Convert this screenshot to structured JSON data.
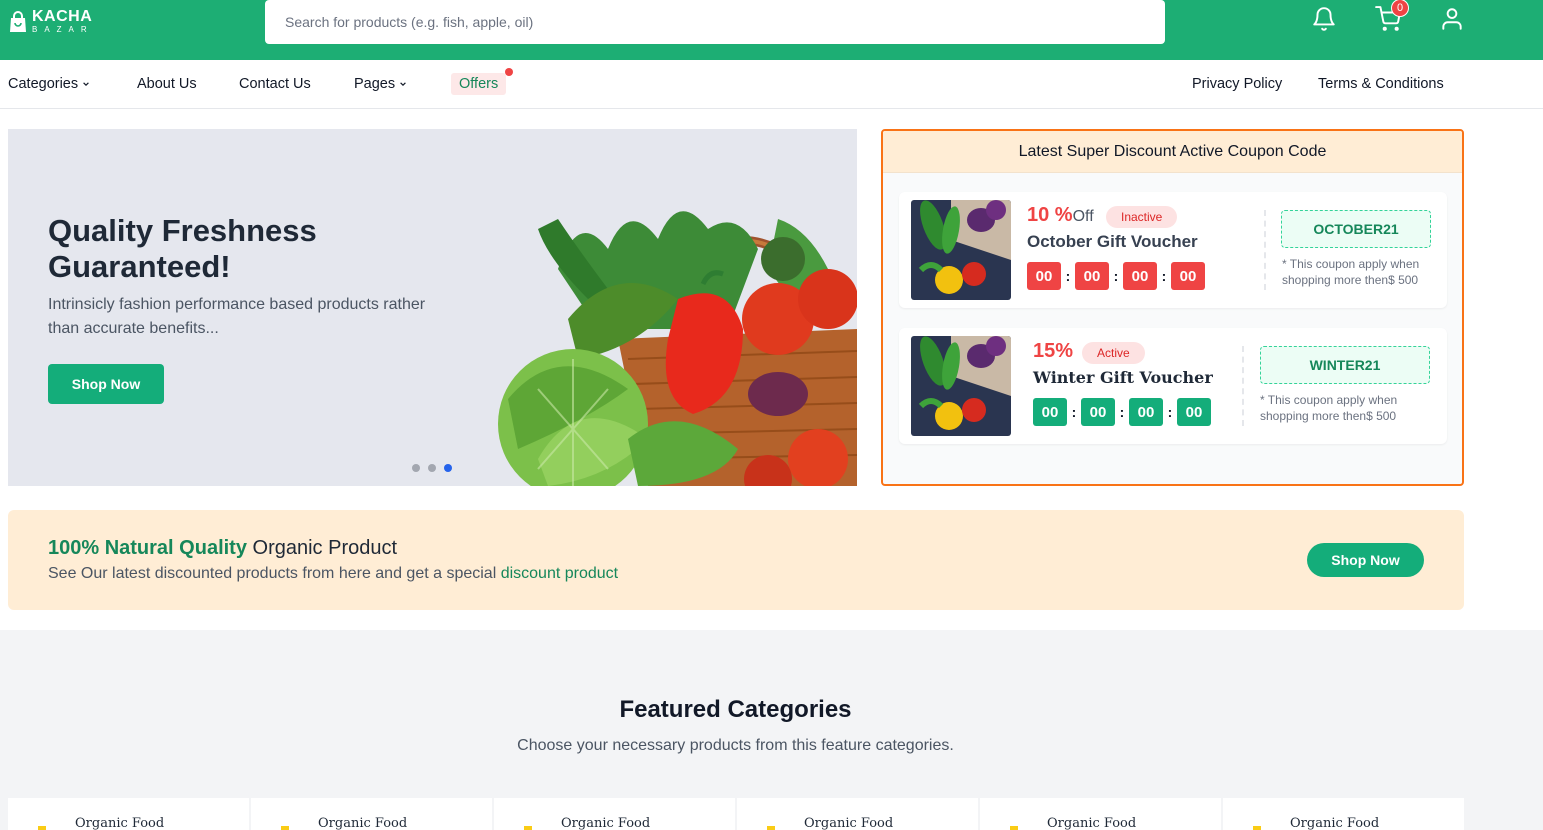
{
  "brand": {
    "name": "KACHA",
    "tagline": "BAZAR"
  },
  "search": {
    "placeholder": "Search for products (e.g. fish, apple, oil)"
  },
  "header_icons": {
    "notification": "bell-icon",
    "cart": "cart-icon",
    "user": "user-icon",
    "cart_count": "0"
  },
  "nav": {
    "categories": "Categories",
    "about": "About Us",
    "contact": "Contact Us",
    "pages": "Pages",
    "offers": "Offers",
    "privacy": "Privacy Policy",
    "terms": "Terms & Conditions"
  },
  "hero": {
    "title": "Quality Freshness Guaranteed!",
    "subtitle": "Intrinsicly fashion performance based products rather than accurate benefits...",
    "button": "Shop Now",
    "slides": 3,
    "active_slide": 3
  },
  "coupons": {
    "heading": "Latest Super Discount Active Coupon Code",
    "items": [
      {
        "percent": "10 %",
        "off": "Off",
        "status": "Inactive",
        "name": "October Gift Voucher",
        "timer": [
          "00",
          "00",
          "00",
          "00"
        ],
        "code": "OCTOBER21",
        "note": "* This coupon apply when shopping more then$ 500"
      },
      {
        "percent": "15%",
        "status": "Active",
        "name": "Winter Gift Voucher",
        "timer": [
          "00",
          "00",
          "00",
          "00"
        ],
        "code": "WINTER21",
        "note": "* This coupon apply when shopping more then$ 500"
      }
    ]
  },
  "promo": {
    "title_highlight": "100% Natural Quality",
    "title_rest": " Organic Product",
    "subtitle": "See Our latest discounted products from here and get a special ",
    "subtitle_link": "discount product",
    "button": "Shop Now"
  },
  "featured": {
    "title": "Featured Categories",
    "subtitle": "Choose your necessary products from this feature categories.",
    "categories": [
      "Organic Food",
      "Organic Food",
      "Organic Food",
      "Organic Food",
      "Organic Food",
      "Organic Food"
    ]
  },
  "colors": {
    "brand_green": "#1dae74",
    "accent_red": "#ef4444",
    "promo_bg": "#ffedd5",
    "coupon_border": "#f97316"
  }
}
